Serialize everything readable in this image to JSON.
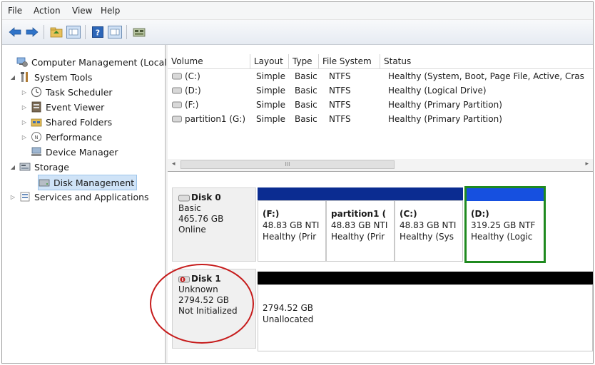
{
  "menu": [
    "File",
    "Action",
    "View",
    "Help"
  ],
  "toolbar": {
    "icons": [
      "back-arrow-icon",
      "forward-arrow-icon",
      "folder-up-icon",
      "show-hide-tree-icon",
      "help-icon",
      "properties-icon",
      "disk-icon"
    ]
  },
  "tree": {
    "root": "Computer Management (Local",
    "system_tools": "System Tools",
    "task_scheduler": "Task Scheduler",
    "event_viewer": "Event Viewer",
    "shared_folders": "Shared Folders",
    "performance": "Performance",
    "device_manager": "Device Manager",
    "storage": "Storage",
    "disk_management": "Disk Management",
    "services": "Services and Applications"
  },
  "volumes": {
    "columns": [
      "Volume",
      "Layout",
      "Type",
      "File System",
      "Status"
    ],
    "rows": [
      {
        "volume": "(C:)",
        "layout": "Simple",
        "type": "Basic",
        "fs": "NTFS",
        "status": "Healthy (System, Boot, Page File, Active, Cras"
      },
      {
        "volume": "(D:)",
        "layout": "Simple",
        "type": "Basic",
        "fs": "NTFS",
        "status": "Healthy (Logical Drive)"
      },
      {
        "volume": "(F:)",
        "layout": "Simple",
        "type": "Basic",
        "fs": "NTFS",
        "status": "Healthy (Primary Partition)"
      },
      {
        "volume": "partition1 (G:)",
        "layout": "Simple",
        "type": "Basic",
        "fs": "NTFS",
        "status": "Healthy (Primary Partition)"
      }
    ],
    "scroll_thumb": "III"
  },
  "disks": [
    {
      "name": "Disk 0",
      "type": "Basic",
      "size": "465.76 GB",
      "state": "Online",
      "partitions": [
        {
          "name": "(F:)",
          "size": "48.83 GB NTI",
          "status": "Healthy (Prir"
        },
        {
          "name": "partition1 (",
          "size": "48.83 GB NTI",
          "status": "Healthy (Prir"
        },
        {
          "name": "(C:)",
          "size": "48.83 GB NTI",
          "status": "Healthy (Sys"
        },
        {
          "name": "(D:)",
          "size": "319.25 GB NTF",
          "status": "Healthy (Logic"
        }
      ]
    },
    {
      "name": "Disk 1",
      "type": "Unknown",
      "size": "2794.52 GB",
      "state": "Not Initialized",
      "partitions": [
        {
          "size": "2794.52 GB",
          "status": "Unallocated"
        }
      ]
    }
  ],
  "colors": {
    "primary_partition": "#0b2c91",
    "logical_drive": "#1650e0",
    "unallocated": "#000000",
    "selection_outline": "#1f8a1f",
    "annotation_circle": "#c61b1b"
  }
}
